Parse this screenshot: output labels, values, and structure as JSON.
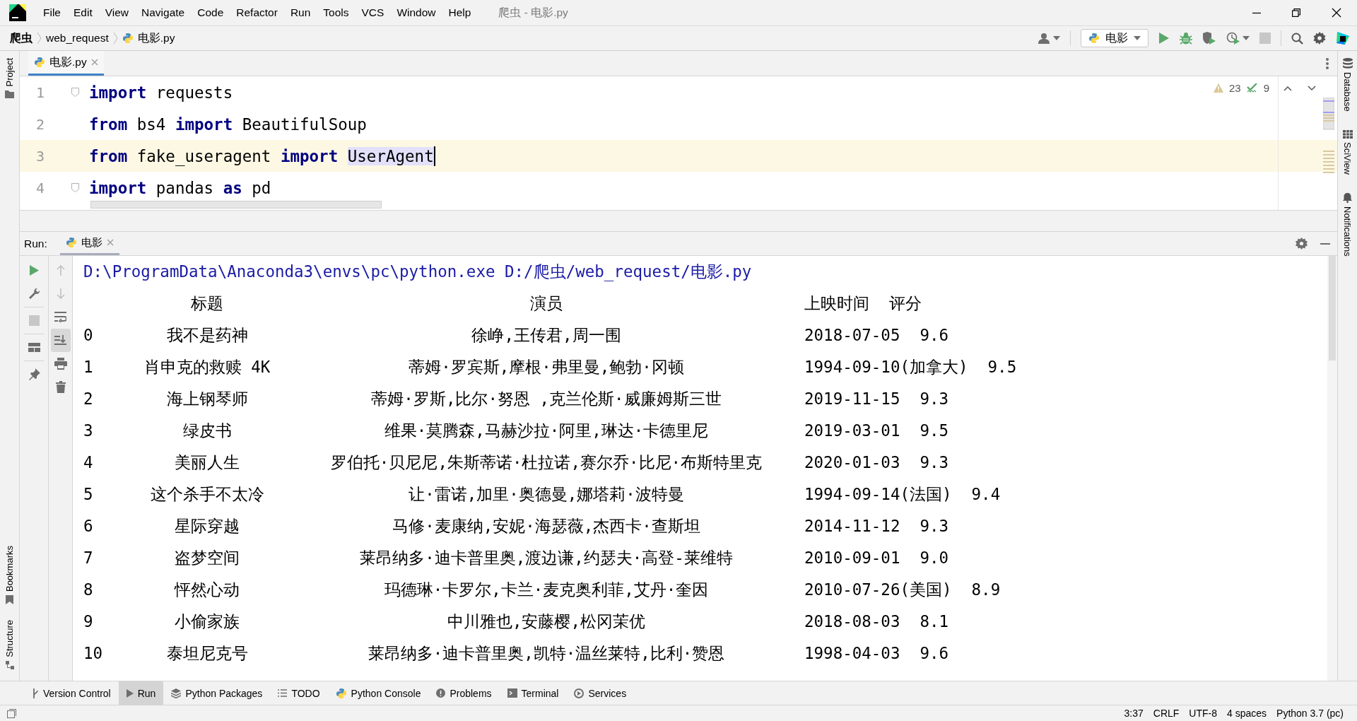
{
  "window": {
    "title": "爬虫 - 电影.py",
    "menu": [
      "File",
      "Edit",
      "View",
      "Navigate",
      "Code",
      "Refactor",
      "Run",
      "Tools",
      "VCS",
      "Window",
      "Help"
    ]
  },
  "navigation": {
    "breadcrumb": [
      "爬虫",
      "web_request",
      "电影.py"
    ],
    "run_configuration": "电影"
  },
  "left_stripe": {
    "top": [
      "Project"
    ],
    "bottom": [
      "Bookmarks",
      "Structure"
    ]
  },
  "right_stripe": [
    "Database",
    "SciView",
    "Notifications"
  ],
  "editor": {
    "tab": "电影.py",
    "warnings": "23",
    "weak_warnings": "9",
    "lines": [
      {
        "number": "1",
        "current": false,
        "tokens": [
          {
            "text": "import",
            "kind": "keyword",
            "selected": false
          },
          {
            "text": " requests",
            "kind": "plain",
            "selected": false
          }
        ]
      },
      {
        "number": "2",
        "current": false,
        "tokens": [
          {
            "text": "from",
            "kind": "keyword",
            "selected": false
          },
          {
            "text": " bs4 ",
            "kind": "plain",
            "selected": false
          },
          {
            "text": "import",
            "kind": "keyword",
            "selected": false
          },
          {
            "text": " BeautifulSoup",
            "kind": "plain",
            "selected": false
          }
        ]
      },
      {
        "number": "3",
        "current": true,
        "tokens": [
          {
            "text": "from",
            "kind": "keyword",
            "selected": false
          },
          {
            "text": " fake_useragent ",
            "kind": "plain",
            "selected": false
          },
          {
            "text": "import ",
            "kind": "keyword",
            "selected": false
          },
          {
            "text": "UserAgent",
            "kind": "plain",
            "selected": true
          }
        ]
      },
      {
        "number": "4",
        "current": false,
        "tokens": [
          {
            "text": "import",
            "kind": "keyword",
            "selected": false
          },
          {
            "text": " pandas ",
            "kind": "plain",
            "selected": false
          },
          {
            "text": "as",
            "kind": "keyword",
            "selected": false
          },
          {
            "text": " pd",
            "kind": "plain",
            "selected": false
          }
        ]
      }
    ]
  },
  "run": {
    "label": "Run:",
    "tab": "电影",
    "command": "D:\\ProgramData\\Anaconda3\\envs\\pc\\python.exe D:/爬虫/web_request/电影.py",
    "header": [
      "标题",
      "演员",
      "上映时间",
      "评分"
    ],
    "rows": [
      {
        "index": "0",
        "title": "我不是药神",
        "actors": "徐峥,王传君,周一围",
        "date": "2018-07-05",
        "score": "9.6"
      },
      {
        "index": "1",
        "title": "肖申克的救赎 4K",
        "actors": "蒂姆·罗宾斯,摩根·弗里曼,鲍勃·冈顿",
        "date": "1994-09-10(加拿大)",
        "score": "9.5"
      },
      {
        "index": "2",
        "title": "海上钢琴师",
        "actors": "蒂姆·罗斯,比尔·努恩 ,克兰伦斯·威廉姆斯三世",
        "date": "2019-11-15",
        "score": "9.3"
      },
      {
        "index": "3",
        "title": "绿皮书",
        "actors": "维果·莫腾森,马赫沙拉·阿里,琳达·卡德里尼",
        "date": "2019-03-01",
        "score": "9.5"
      },
      {
        "index": "4",
        "title": "美丽人生",
        "actors": "罗伯托·贝尼尼,朱斯蒂诺·杜拉诺,赛尔乔·比尼·布斯特里克",
        "date": "2020-01-03",
        "score": "9.3"
      },
      {
        "index": "5",
        "title": "这个杀手不太冷",
        "actors": "让·雷诺,加里·奥德曼,娜塔莉·波特曼",
        "date": "1994-09-14(法国)",
        "score": "9.4"
      },
      {
        "index": "6",
        "title": "星际穿越",
        "actors": "马修·麦康纳,安妮·海瑟薇,杰西卡·查斯坦",
        "date": "2014-11-12",
        "score": "9.3"
      },
      {
        "index": "7",
        "title": "盗梦空间",
        "actors": "莱昂纳多·迪卡普里奥,渡边谦,约瑟夫·高登-莱维特",
        "date": "2010-09-01",
        "score": "9.0"
      },
      {
        "index": "8",
        "title": "怦然心动",
        "actors": "玛德琳·卡罗尔,卡兰·麦克奥利菲,艾丹·奎因",
        "date": "2010-07-26(美国)",
        "score": "8.9"
      },
      {
        "index": "9",
        "title": "小偷家族",
        "actors": "中川雅也,安藤樱,松冈茉优",
        "date": "2018-08-03",
        "score": "8.1"
      },
      {
        "index": "10",
        "title": "泰坦尼克号",
        "actors": "莱昂纳多·迪卡普里奥,凯特·温丝莱特,比利·赞恩",
        "date": "1998-04-03",
        "score": "9.6"
      }
    ]
  },
  "tool_windows": [
    {
      "label": "Version Control",
      "selected": false
    },
    {
      "label": "Run",
      "selected": true
    },
    {
      "label": "Python Packages",
      "selected": false
    },
    {
      "label": "TODO",
      "selected": false
    },
    {
      "label": "Python Console",
      "selected": false
    },
    {
      "label": "Problems",
      "selected": false
    },
    {
      "label": "Terminal",
      "selected": false
    },
    {
      "label": "Services",
      "selected": false
    }
  ],
  "status_bar": [
    "3:37",
    "CRLF",
    "UTF-8",
    "4 spaces",
    "Python 3.7 (pc)"
  ]
}
